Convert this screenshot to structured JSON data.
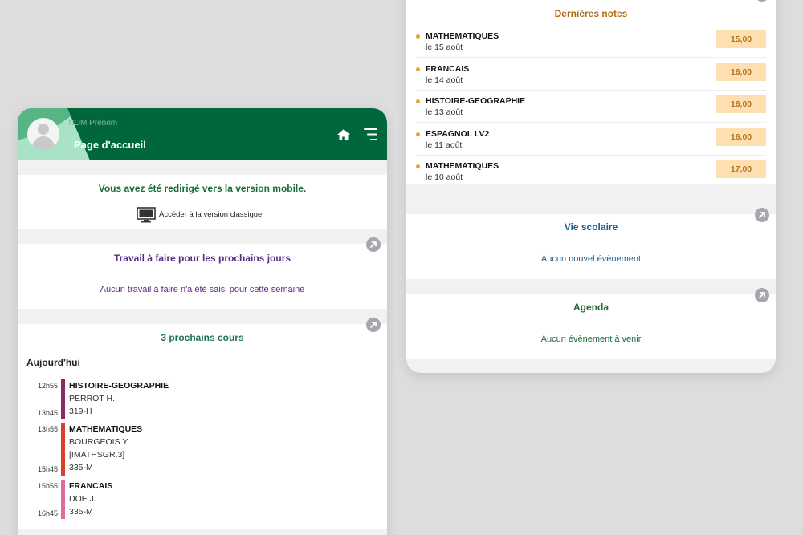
{
  "colors": {
    "brand_green": "#00673c",
    "work_purple": "#5b2c83",
    "courses_teal": "#1f6f5d",
    "grades_orange": "#b46a12",
    "school_blue": "#1f5f8e",
    "agenda_green": "#1b6b3e"
  },
  "header": {
    "user_name": "NOM Prénom",
    "page_title": "Page d'accueil",
    "home_icon": "home-icon",
    "menu_icon": "menu-icon"
  },
  "redirect": {
    "message": "Vous avez été redirigé vers la version mobile.",
    "classic_link": "Accéder à la version classique"
  },
  "homework": {
    "title": "Travail à faire pour les prochains jours",
    "empty": "Aucun travail à faire n'a été saisi pour cette semaine"
  },
  "courses": {
    "title": "3 prochains cours",
    "day_label": "Aujourd'hui",
    "items": [
      {
        "start": "12h55",
        "end": "13h45",
        "subject": "HISTOIRE-GEOGRAPHIE",
        "lines": [
          "PERROT H.",
          "319-H"
        ],
        "color": "#8d2a63"
      },
      {
        "start": "13h55",
        "end": "15h45",
        "subject": "MATHEMATIQUES",
        "lines": [
          "BOURGEOIS Y.",
          "[IMATHSGR.3]",
          "335-M"
        ],
        "color": "#d9402d"
      },
      {
        "start": "15h55",
        "end": "16h45",
        "subject": "FRANCAIS",
        "lines": [
          "DOE J.",
          "335-M"
        ],
        "color": "#e36aa0"
      }
    ]
  },
  "grades": {
    "title": "Dernières notes",
    "items": [
      {
        "subject": "MATHEMATIQUES",
        "date": "le 15 août",
        "grade": "15,00"
      },
      {
        "subject": "FRANCAIS",
        "date": "le 14 août",
        "grade": "16,00"
      },
      {
        "subject": "HISTOIRE-GEOGRAPHIE",
        "date": "le 13 août",
        "grade": "16,00"
      },
      {
        "subject": "ESPAGNOL LV2",
        "date": "le 11 août",
        "grade": "16,00"
      },
      {
        "subject": "MATHEMATIQUES",
        "date": "le 10 août",
        "grade": "17,00"
      }
    ]
  },
  "school_life": {
    "title": "Vie scolaire",
    "empty": "Aucun nouvel évènement"
  },
  "agenda": {
    "title": "Agenda",
    "empty": "Aucun évènement à venir"
  }
}
